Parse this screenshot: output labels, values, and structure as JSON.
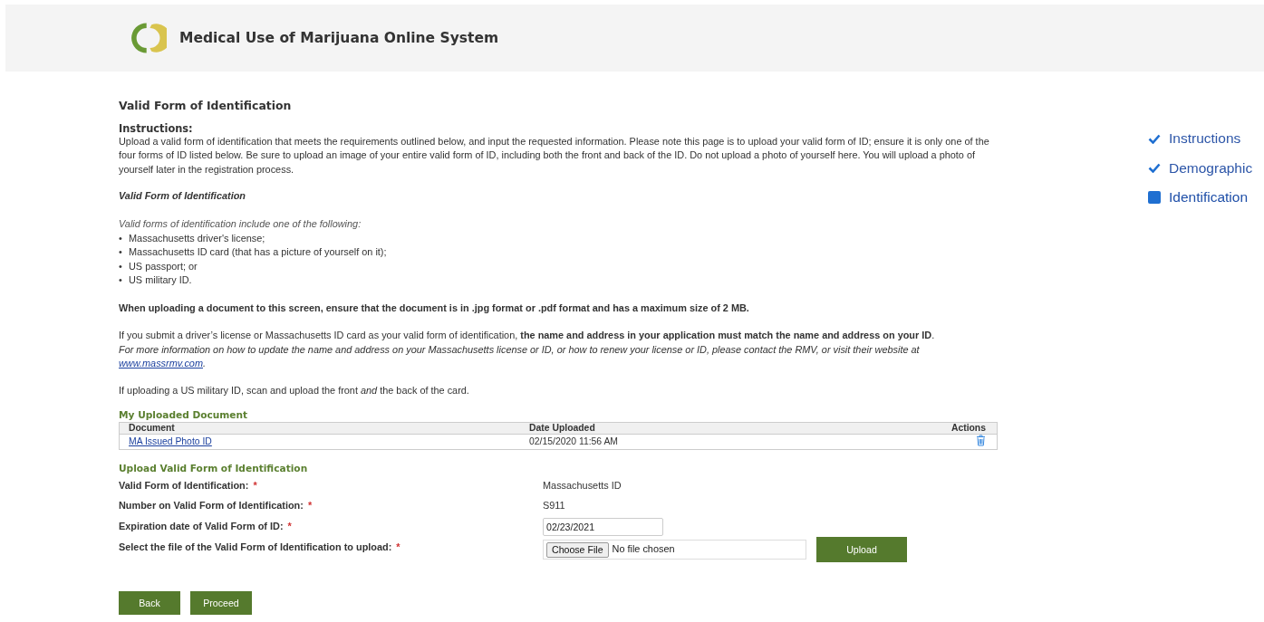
{
  "header": {
    "title": "Medical Use of Marijuana Online System"
  },
  "page_title": "Valid Form of Identification",
  "instructions": {
    "heading": "Instructions:",
    "text": "Upload a valid form of identification that meets the requirements outlined below, and input the requested information. Please note this page is to upload your valid form of ID; ensure it is only one of the four forms of ID listed below. Be sure to upload an image of your entire valid form of ID, including both the front and back of the ID. Do not upload a photo of yourself here. You will upload a photo of yourself later in the registration process."
  },
  "valid_forms": {
    "heading": "Valid Form of Identification",
    "intro": "Valid forms of identification include one of the following:",
    "bullet": "•",
    "items": [
      "Massachusetts driver's license;",
      "Massachusetts ID card (that has a picture of yourself on it);",
      "US passport; or",
      "US military ID."
    ]
  },
  "upload_note": "When uploading a document to this screen, ensure that the document is in .jpg format or .pdf format and has a maximum size of 2 MB.",
  "match_note": "If you submit a driver’s license or Massachusetts ID card as your valid form of identification, **the name and address in your application must match the name and address on your ID**.",
  "rmv_note": {
    "text": "For more information on how to update the name and address on your Massachusetts license or ID, or how to renew your license or ID, please contact the RMV, or visit their website at",
    "link": "www.massrmv.com",
    "after": "."
  },
  "military_note": "If uploading a US military ID, scan and upload the front *and* the back of the card.",
  "uploaded": {
    "heading": "My Uploaded Document",
    "columns": [
      "Document",
      "Date Uploaded",
      "Actions"
    ],
    "rows": [
      {
        "document": "MA Issued Photo ID",
        "date": "02/15/2020 11:56 AM"
      }
    ]
  },
  "upload_form": {
    "heading": "Upload Valid Form of Identification",
    "fields": [
      {
        "kind": "text",
        "label": "Valid Form of Identification:",
        "required_mark": "*",
        "value": "Massachusetts ID"
      },
      {
        "kind": "text",
        "label": "Number on Valid Form of Identification:",
        "required_mark": "*",
        "value": "S911"
      },
      {
        "kind": "input",
        "label": "Expiration date of Valid Form of ID:",
        "required_mark": "*",
        "value": "02/23/2021"
      },
      {
        "kind": "file",
        "label": "Select the file of the Valid Form of Identification to upload:",
        "required_mark": "*",
        "button": "Choose File",
        "status": "No file chosen",
        "action": "Upload"
      }
    ]
  },
  "buttons": [
    "Back",
    "Proceed"
  ],
  "steps": [
    {
      "kind": "done",
      "label": "Instructions",
      "selected": false
    },
    {
      "kind": "done",
      "label": "Demographic",
      "selected": false
    },
    {
      "kind": "current",
      "label": "Identification",
      "selected": true
    }
  ]
}
